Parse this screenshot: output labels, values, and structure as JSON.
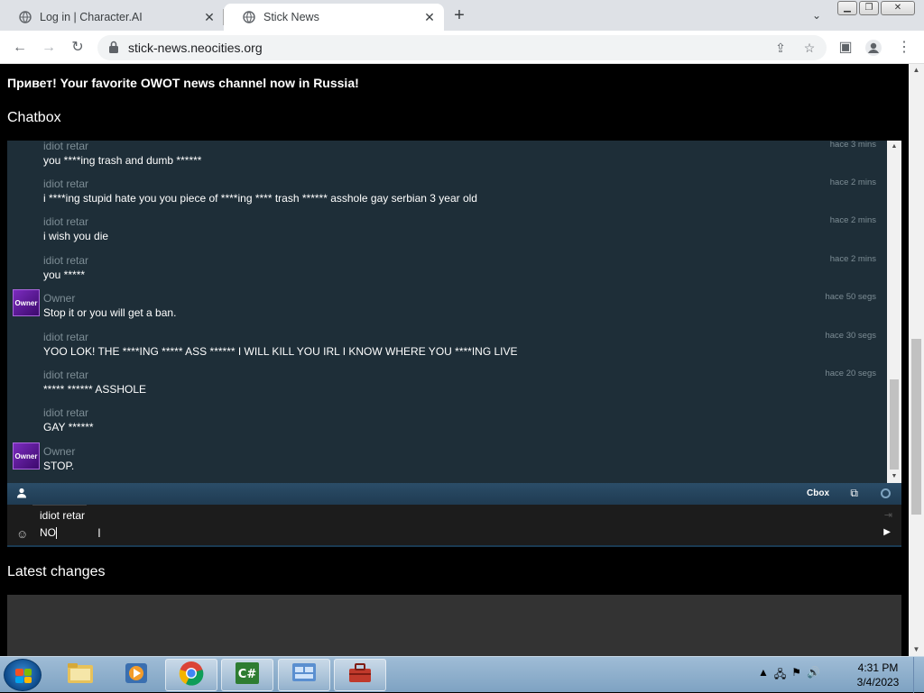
{
  "browser": {
    "tabs": [
      {
        "title": "Log in | Character.AI",
        "active": false
      },
      {
        "title": "Stick News",
        "active": true
      }
    ],
    "url": "stick-news.neocities.org"
  },
  "page": {
    "headline": "Привет! Your favorite OWOT news channel now in Russia!",
    "chatbox_heading": "Chatbox",
    "latest_changes_heading": "Latest changes"
  },
  "chatbox": {
    "messages": [
      {
        "user": "idiot retar",
        "time": "hace 3 mins",
        "text": "you ****ing trash and dumb ******",
        "avatar": ""
      },
      {
        "user": "idiot retar",
        "time": "hace 2 mins",
        "text": "i ****ing stupid hate you you piece of ****ing **** trash ****** asshole gay serbian 3 year old",
        "avatar": ""
      },
      {
        "user": "idiot retar",
        "time": "hace 2 mins",
        "text": "i wish you die",
        "avatar": ""
      },
      {
        "user": "idiot retar",
        "time": "hace 2 mins",
        "text": "you *****",
        "avatar": ""
      },
      {
        "user": "Owner",
        "time": "hace 50 segs",
        "text": "Stop it or you will get a ban.",
        "avatar": "Owner"
      },
      {
        "user": "idiot retar",
        "time": "hace 30 segs",
        "text": "YOO LOK! THE ****ING ***** ASS ****** I WILL KILL YOU IRL I KNOW WHERE YOU ****ING LIVE",
        "avatar": ""
      },
      {
        "user": "idiot retar",
        "time": "hace 20 segs",
        "text": "***** ****** ASSHOLE",
        "avatar": ""
      },
      {
        "user": "idiot retar",
        "time": "",
        "text": "GAY ******",
        "avatar": ""
      },
      {
        "user": "Owner",
        "time": "",
        "text": "STOP.",
        "avatar": "Owner"
      }
    ],
    "bar_label": "Cbox",
    "input_name": "idiot retar",
    "input_value": "NO"
  },
  "taskbar": {
    "time": "4:31 PM",
    "date": "3/4/2023"
  },
  "colors": {
    "chat_bg": "#1e2e38",
    "bar_bg": "#2b4d68",
    "page_bg": "#000000"
  }
}
